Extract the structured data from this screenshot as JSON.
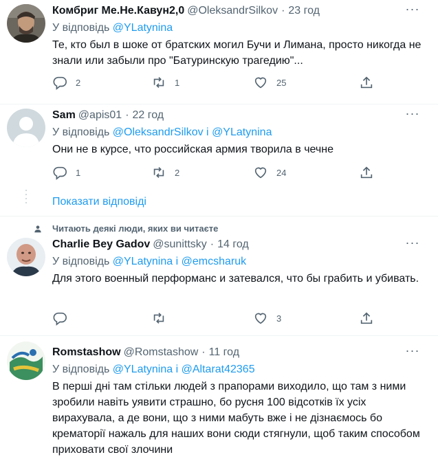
{
  "tweets": [
    {
      "name": "Комбриг Ме.Не.Кавун2,0",
      "handle": "@OleksandrSilkov",
      "dot": "·",
      "time": "23 год",
      "reply_prefix": "У відповідь",
      "mentions": [
        "@YLatynina"
      ],
      "text": "Те, кто был в шоке от братских могил Бучи и Лимана, просто никогда не знали или забыли про \"Батуринскую трагедию\"...",
      "replies": "2",
      "retweets": "1",
      "likes": "25"
    },
    {
      "name": "Sam",
      "handle": "@apis01",
      "dot": "·",
      "time": "22 год",
      "reply_prefix": "У відповідь",
      "mentions": [
        "@OleksandrSilkov",
        "@YLatynina"
      ],
      "joiner": "і",
      "text": "Они не в курсе, что российская армия творила в чечне",
      "replies": "1",
      "retweets": "2",
      "likes": "24"
    },
    {
      "name": "Charlie Bey Gadov",
      "handle": "@sunittsky",
      "dot": "·",
      "time": "14 год",
      "reply_prefix": "У відповідь",
      "mentions": [
        "@YLatynina",
        "@emcsharuk"
      ],
      "joiner": "і",
      "text": "Для этого военный перформанс и затевался, что бы грабить и убивать.",
      "replies": "",
      "retweets": "",
      "likes": "3"
    },
    {
      "name": "Romstashow",
      "handle": "@Romstashow",
      "dot": "·",
      "time": "11 год",
      "reply_prefix": "У відповідь",
      "mentions": [
        "@YLatynina",
        "@Altarat42365"
      ],
      "joiner": "і",
      "text": "В перші дні там стільки людей з прапорами виходило, що там з ними зробили навіть уявити страшно, бо русня 100 відсотків їх усіх вирахувала, а де вони, що з ними мабуть вже і не дізнаємось бо крематорії нажаль для наших вони сюди стягнули, щоб таким способом приховати свої злочини"
    }
  ],
  "thread": {
    "show_replies": "Показати відповіді"
  },
  "social_context": {
    "label": "Читають деякі люди, яких ви читаєте",
    "icon": "person-icon"
  },
  "colors": {
    "accent": "#1d9bf0",
    "secondary_text": "#536471",
    "primary_text": "#0f1419",
    "divider": "#eff3f4"
  }
}
